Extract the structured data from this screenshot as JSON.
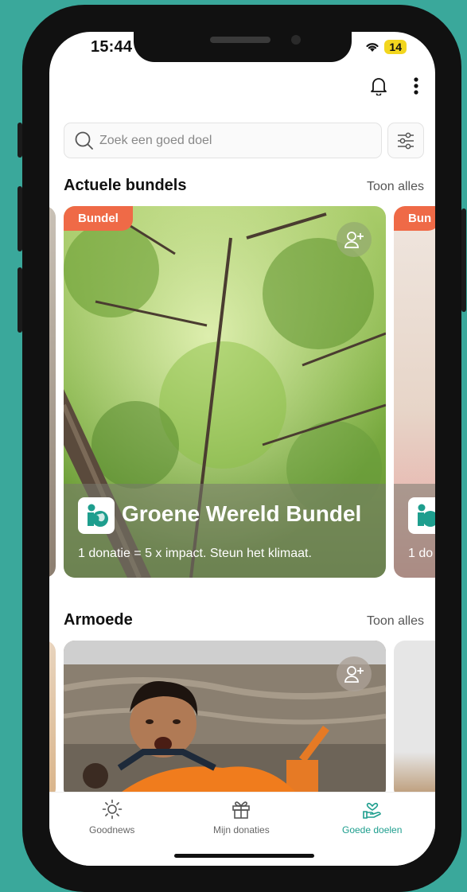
{
  "status_bar": {
    "time": "15:44",
    "battery": "14"
  },
  "search": {
    "placeholder": "Zoek een goed doel"
  },
  "sections": [
    {
      "title": "Actuele bundels",
      "link": "Toon alles"
    },
    {
      "title": "Armoede",
      "link": "Toon alles"
    }
  ],
  "bundle_card": {
    "badge": "Bundel",
    "title": "Groene Wereld Bundel",
    "subtitle": "1 donatie = 5 x impact. Steun het klimaat."
  },
  "peek_card": {
    "badge": "Bun",
    "subtitle": "1 do"
  },
  "tabs": [
    {
      "label": "Goodnews",
      "icon": "sun-icon"
    },
    {
      "label": "Mijn donaties",
      "icon": "gift-icon"
    },
    {
      "label": "Goede doelen",
      "icon": "hand-heart-icon"
    }
  ],
  "colors": {
    "background": "#3aa89b",
    "accent": "#1e9e8e",
    "badge": "#ef6a47"
  }
}
